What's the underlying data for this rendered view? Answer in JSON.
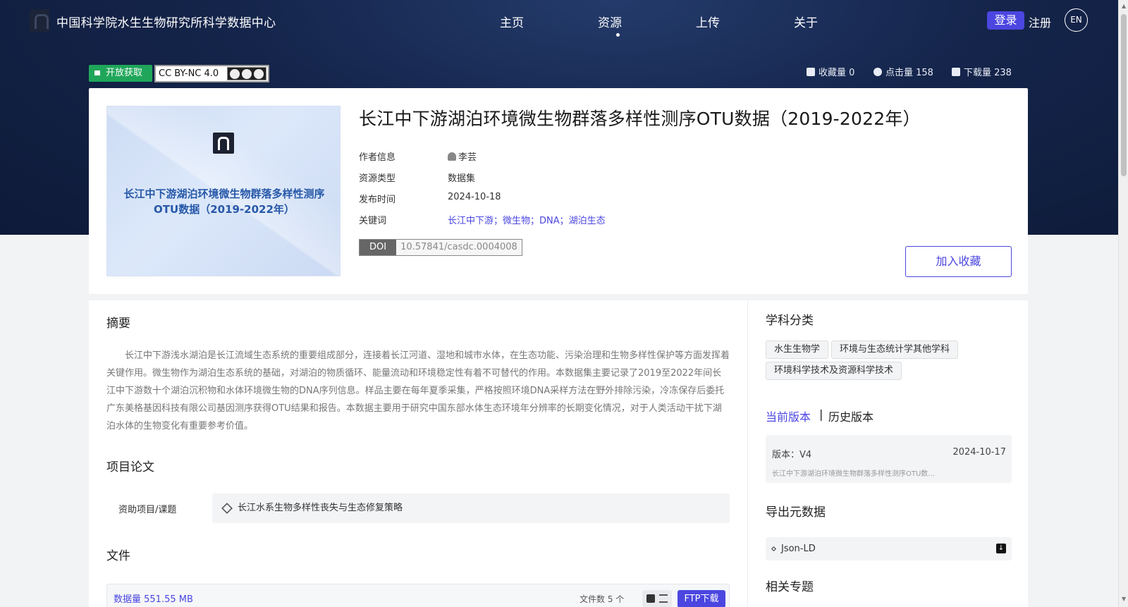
{
  "header": {
    "site_name": "中国科学院水生生物研究所科学数据中心",
    "nav": [
      "主页",
      "资源",
      "上传",
      "关于"
    ],
    "active_nav": "资源",
    "login": "登录",
    "register": "注册",
    "lang": "EN"
  },
  "badges": {
    "open_access": "开放获取",
    "license": "CC BY-NC 4.0"
  },
  "stats": {
    "favorites": "收藏量 0",
    "views": "点击量 158",
    "downloads": "下载量 238"
  },
  "dataset": {
    "cover_title": "长江中下游湖泊环境微生物群落多样性测序OTU数据（2019-2022年）",
    "title": "长江中下游湖泊环境微生物群落多样性测序OTU数据（2019-2022年）",
    "author_label": "作者信息",
    "author": "李芸",
    "type_label": "资源类型",
    "type": "数据集",
    "date_label": "发布时间",
    "date": "2024-10-18",
    "keywords_label": "关键词",
    "keywords": "长江中下游；微生物；DNA；湖泊生态",
    "doi_tag": "DOI",
    "doi": "10.57841/casdc.0004008",
    "fav_button": "加入收藏"
  },
  "abstract": {
    "heading": "摘要",
    "text": "长江中下游浅水湖泊是长江流域生态系统的重要组成部分，连接着长江河道、湿地和城市水体，在生态功能、污染治理和生物多样性保护等方面发挥着关键作用。微生物作为湖泊生态系统的基础，对湖泊的物质循环、能量流动和环境稳定性有着不可替代的作用。本数据集主要记录了2019至2022年间长江中下游数十个湖泊沉积物和水体环境微生物的DNA序列信息。样品主要在每年夏季采集，严格按照环境DNA采样方法在野外排除污染，冷冻保存后委托广东美格基因科技有限公司基因测序获得OTU结果和报告。本数据主要用于研究中国东部水体生态环境年分辨率的长期变化情况，对于人类活动干扰下湖泊水体的生物变化有重要参考价值。"
  },
  "project": {
    "heading": "项目论文",
    "label": "资助项目/课题",
    "name": "长江水系生物多样性丧失与生态修复策略"
  },
  "files": {
    "heading": "文件",
    "size": "数据量 551.55 MB",
    "count": "文件数 5 个",
    "ftp": "FTP下载"
  },
  "sidebar": {
    "subject_heading": "学科分类",
    "subjects": [
      "水生生物学",
      "环境与生态统计学其他学科",
      "环境科学技术及资源科学技术"
    ],
    "current_version": "当前版本",
    "separator": "|",
    "history_version": "历史版本",
    "version_label": "版本：V4",
    "version_date": "2024-10-17",
    "version_desc": "长江中下游湖泊环境微生物群落多样性测序OTU数...",
    "export_heading": "导出元数据",
    "export_format": "Json-LD",
    "related_heading": "相关专题"
  },
  "colors": {
    "accent": "#4b46e0",
    "open_access": "#1fa65a",
    "hero": "#14244a"
  }
}
